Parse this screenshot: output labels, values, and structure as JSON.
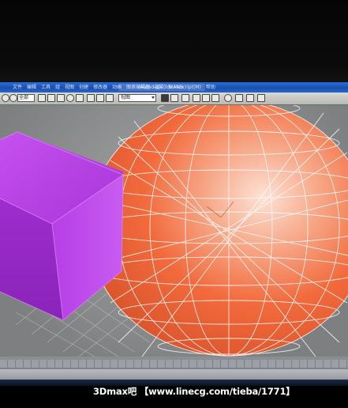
{
  "window": {
    "title": "Autodesk 3ds Max",
    "menu": [
      "文件",
      "编辑",
      "工具",
      "组",
      "视图",
      "创建",
      "修改器",
      "动画",
      "图表编辑器",
      "渲染",
      "MAXScript(M)",
      "帮助"
    ]
  },
  "toolbar": {
    "selection_filter": "全部",
    "view_dropdown": "视图"
  },
  "viewport": {
    "objects": [
      {
        "name": "Box",
        "color": "#b23be0"
      },
      {
        "name": "Sphere",
        "color": "#f26a3c"
      }
    ]
  },
  "watermark": {
    "text": "3Dmax吧 【www.linecg.com/tieba/1771】"
  },
  "colors": {
    "titlebar": "#1a4fb0",
    "box": "#b23be0",
    "sphere": "#f26a3c",
    "sphere_highlight": "#fde2d6",
    "wire": "#ffffff"
  }
}
